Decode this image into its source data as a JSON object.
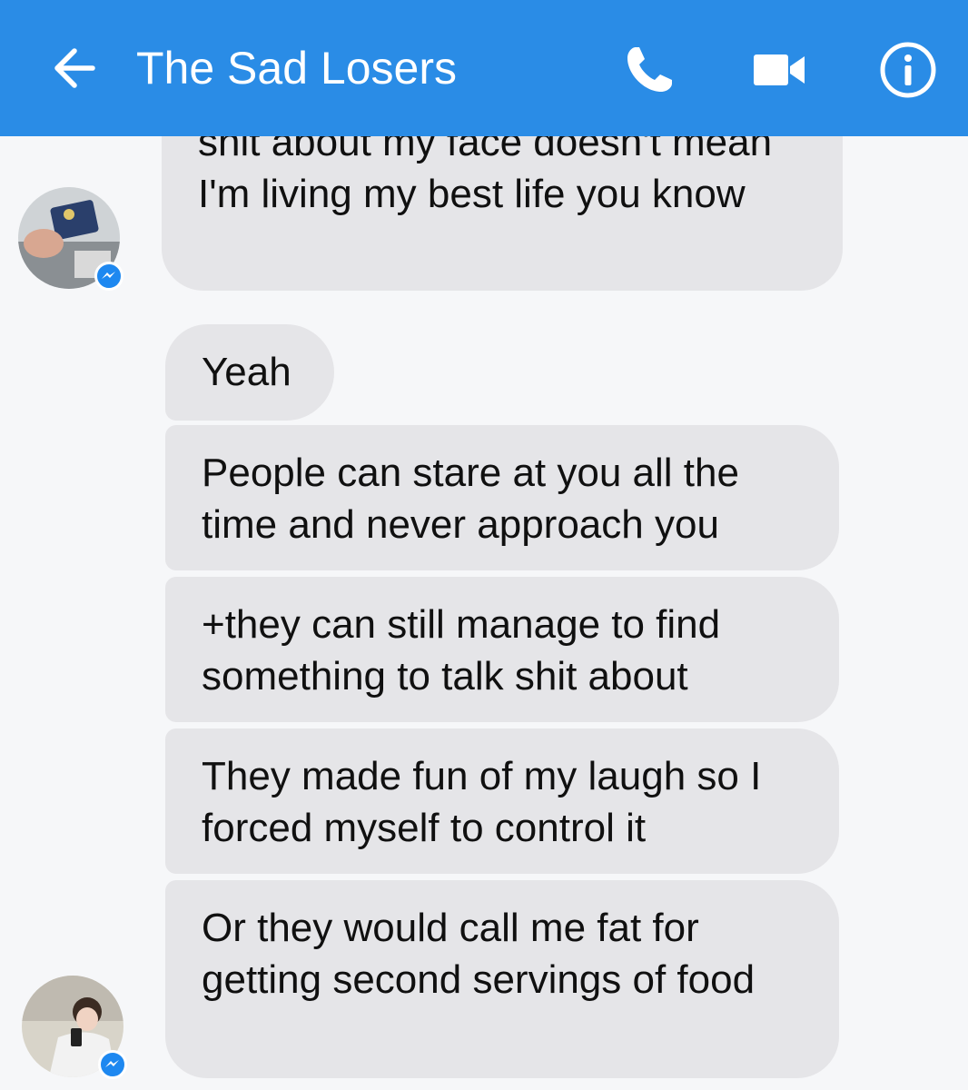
{
  "header": {
    "title": "The Sad Losers",
    "back_icon": "arrow-left-icon",
    "call_icon": "phone-icon",
    "video_icon": "video-camera-icon",
    "info_icon": "info-icon",
    "bg_color": "#2a8ce6"
  },
  "messages": [
    {
      "text": "shit about my face doesn't mean I'm living my best life you know",
      "sender": "avatar-1"
    },
    {
      "text": "Yeah",
      "sender": "avatar-2"
    },
    {
      "text": "People can stare at you all the time and never approach you",
      "sender": "avatar-2"
    },
    {
      "text": "+they can still manage to find something to talk shit about",
      "sender": "avatar-2"
    },
    {
      "text": "They made fun of my laugh so I forced myself to control it",
      "sender": "avatar-2"
    },
    {
      "text": "Or they would call me fat for getting second servings of food",
      "sender": "avatar-2"
    }
  ],
  "avatars": [
    {
      "icon": "messenger-badge-icon"
    },
    {
      "icon": "messenger-badge-icon"
    }
  ]
}
